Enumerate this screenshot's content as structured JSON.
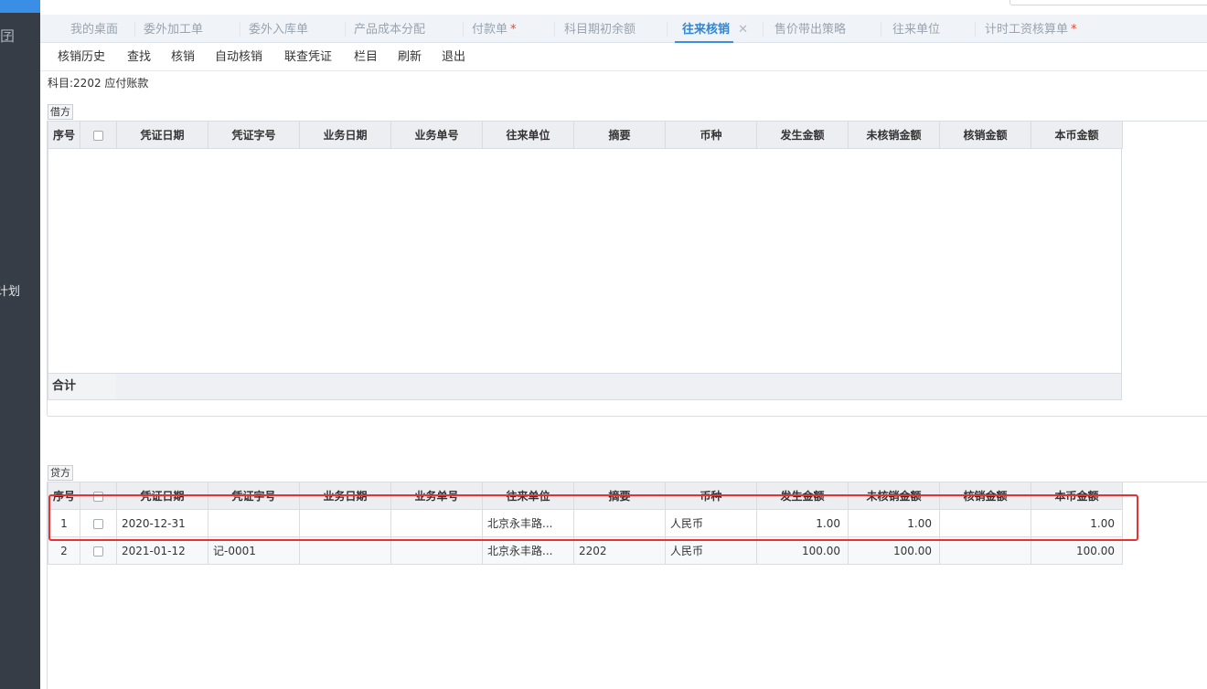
{
  "sidebar": {
    "save_icon": "囝",
    "plan_label": "计划"
  },
  "tabs": [
    {
      "label": "我的桌面",
      "star": ""
    },
    {
      "label": "委外加工单",
      "star": ""
    },
    {
      "label": "委外入库单",
      "star": ""
    },
    {
      "label": "产品成本分配",
      "star": ""
    },
    {
      "label": "付款单",
      "star": "*"
    },
    {
      "label": "科目期初余额",
      "star": ""
    },
    {
      "label": "往来核销",
      "star": "",
      "close": "✕"
    },
    {
      "label": "售价带出策略",
      "star": ""
    },
    {
      "label": "往来单位",
      "star": ""
    },
    {
      "label": "计时工资核算单",
      "star": "*"
    }
  ],
  "toolbar": [
    "核销历史",
    "查找",
    "核销",
    "自动核销",
    "联查凭证",
    "栏目",
    "刷新",
    "退出"
  ],
  "subject": "科目:2202 应付账款",
  "debit": {
    "label": "借方",
    "headers": [
      "序号",
      "",
      "凭证日期",
      "凭证字号",
      "业务日期",
      "业务单号",
      "往来单位",
      "摘要",
      "币种",
      "发生金额",
      "未核销金额",
      "核销金额",
      "本币金额"
    ],
    "total_label": "合计"
  },
  "credit": {
    "label": "贷方",
    "headers": [
      "序号",
      "",
      "凭证日期",
      "凭证字号",
      "业务日期",
      "业务单号",
      "往来单位",
      "摘要",
      "币种",
      "发生金额",
      "未核销金额",
      "核销金额",
      "本币金额"
    ],
    "rows": [
      {
        "no": "1",
        "voucher_date": "2020-12-31",
        "voucher_no": "",
        "biz_date": "",
        "biz_no": "",
        "partner": "北京永丰路...",
        "summary": "",
        "currency": "人民币",
        "amount": "1.00",
        "unwritten": "1.00",
        "written": "",
        "local_amount": "1.00"
      },
      {
        "no": "2",
        "voucher_date": "2021-01-12",
        "voucher_no": "记-0001",
        "biz_date": "",
        "biz_no": "",
        "partner": "北京永丰路...",
        "summary": "2202",
        "currency": "人民币",
        "amount": "100.00",
        "unwritten": "100.00",
        "written": "",
        "local_amount": "100.00"
      }
    ]
  },
  "colors": {
    "active_tab": "#2f86d6",
    "highlight": "#e63232",
    "sidebar": "#373d47"
  }
}
